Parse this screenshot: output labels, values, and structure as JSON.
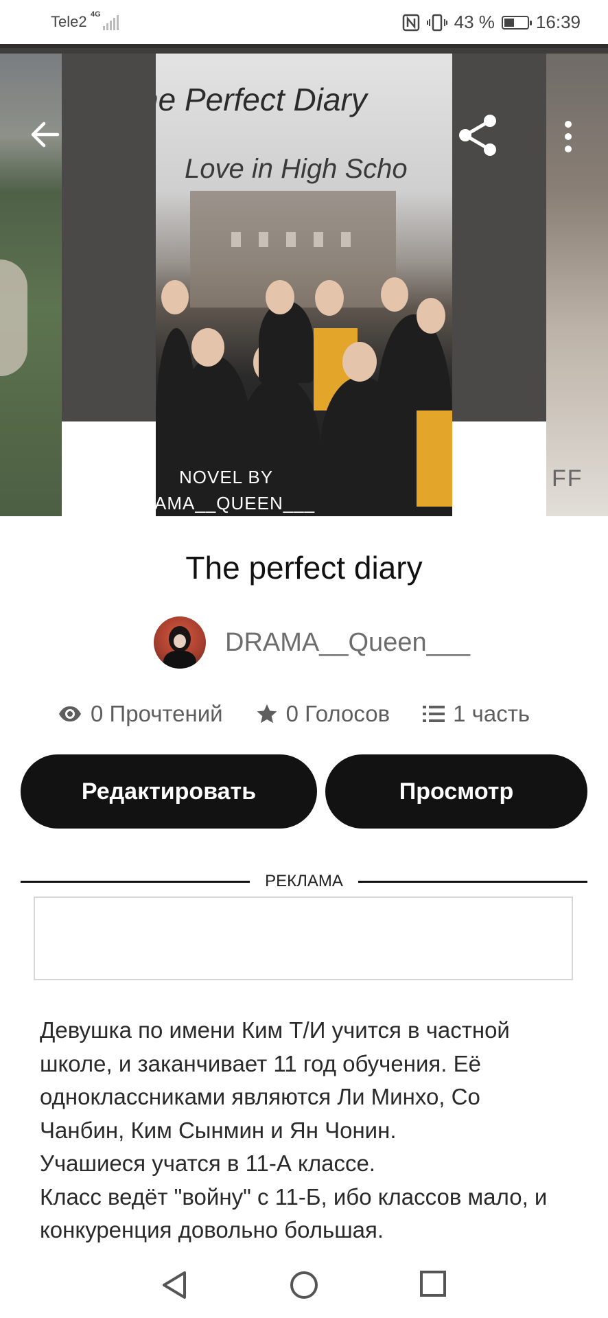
{
  "status_bar": {
    "carrier": "Tele2",
    "network": "4G",
    "battery": "43 %",
    "battery_level": 0.43,
    "time": "16:39"
  },
  "cover": {
    "title_line1": "he Perfect Diary",
    "title_line2": "Love in High Scho",
    "novel_by": "NOVEL BY",
    "author_line": "AMA__QUEEN___"
  },
  "side_right_text": "FF",
  "story": {
    "title": "The perfect diary",
    "author": "DRAMA__Queen___"
  },
  "stats": {
    "reads": "0 Прочтений",
    "votes": "0 Голосов",
    "parts": "1 часть"
  },
  "buttons": {
    "edit": "Редактировать",
    "view": "Просмотр"
  },
  "ad": {
    "label": "РЕКЛАМА"
  },
  "description": [
    "Девушка по имени Ким Т/И учится в частной",
    "школе, и заканчивает 11 год обучения. Её",
    "одноклассниками являются Ли Минхо, Со",
    "Чанбин, Ким Сынмин и Ян Чонин.",
    "Учашиеся учатся в 11-А классе.",
    "Класс ведёт \"войну\" с 11-Б, ибо классов мало, и",
    "конкуренция довольно большая."
  ],
  "icons": {
    "back": "arrow-left-icon",
    "share": "share-icon",
    "more": "more-vertical-icon",
    "reads": "eye-icon",
    "votes": "star-icon",
    "parts": "list-icon",
    "nav_back": "triangle-back-icon",
    "nav_home": "circle-home-icon",
    "nav_recents": "square-recents-icon"
  }
}
